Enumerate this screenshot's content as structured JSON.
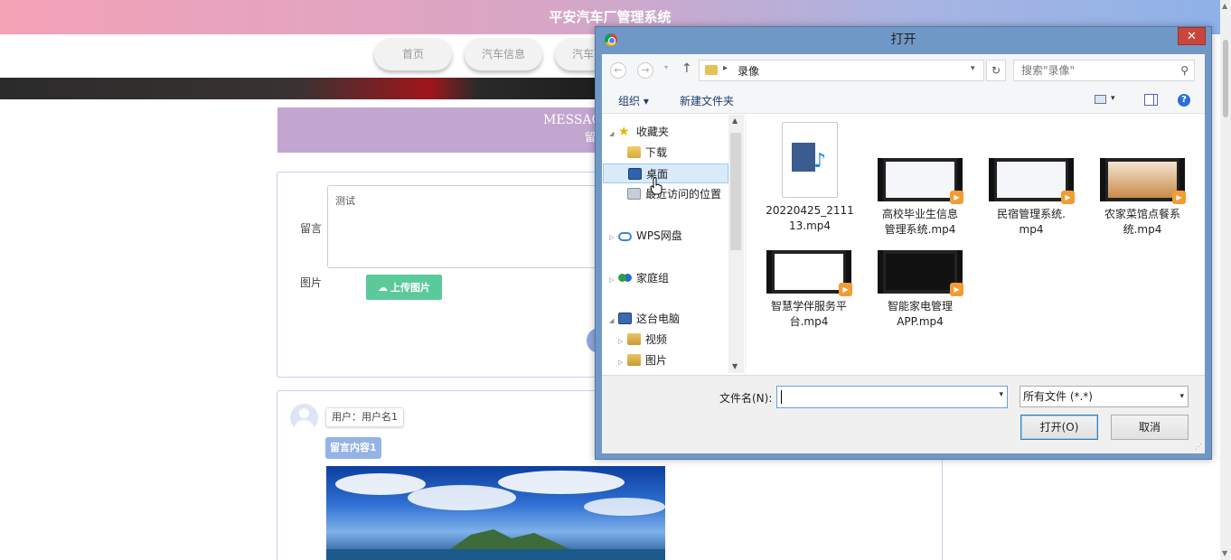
{
  "page": {
    "site_title": "平安汽车厂管理系统",
    "nav": [
      "首页",
      "汽车信息",
      "汽车配件"
    ],
    "section_title": "MESSAG",
    "section_subtitle": "留",
    "form": {
      "message_label": "留言",
      "message_value": "测试",
      "image_label": "图片",
      "upload_label": "上传图片"
    },
    "messages": [
      {
        "user": "用户：用户名1",
        "content": "留言内容1"
      }
    ]
  },
  "dialog": {
    "title": "打开",
    "close": "✕",
    "address": {
      "path": "录像"
    },
    "search_placeholder": "搜索\"录像\"",
    "toolbar": {
      "organize": "组织 ▾",
      "new_folder": "新建文件夹",
      "help": "?"
    },
    "tree": [
      {
        "label": "收藏夹",
        "icon": "star-icon",
        "expander": "◢"
      },
      {
        "label": "下载",
        "icon": "download-folder-icon"
      },
      {
        "label": "桌面",
        "icon": "desktop-icon",
        "selected": true
      },
      {
        "label": "最近访问的位置",
        "icon": "recent-places-icon"
      },
      {
        "label": "WPS网盘",
        "icon": "cloud-icon",
        "expander": "▷"
      },
      {
        "label": "家庭组",
        "icon": "homegroup-icon",
        "expander": "▷"
      },
      {
        "label": "这台电脑",
        "icon": "computer-icon",
        "expander": "◢"
      },
      {
        "label": "视频",
        "icon": "video-folder-icon",
        "expander": "▷"
      },
      {
        "label": "图片",
        "icon": "picture-folder-icon",
        "expander": "▷"
      }
    ],
    "files": [
      {
        "name": "20220425_211113.mp4",
        "line1": "20220425_2111",
        "line2": "13.mp4"
      },
      {
        "name": "高校毕业生信息管理系统.mp4",
        "line1": "高校毕业生信息",
        "line2": "管理系统.mp4"
      },
      {
        "name": "民宿管理系统.mp4",
        "line1": "民宿管理系统.",
        "line2": "mp4"
      },
      {
        "name": "农家菜馆点餐系统.mp4",
        "line1": "农家菜馆点餐系",
        "line2": "统.mp4"
      },
      {
        "name": "智慧学伴服务平台.mp4",
        "line1": "智慧学伴服务平",
        "line2": "台.mp4"
      },
      {
        "name": "智能家电管理APP.mp4",
        "line1": "智能家电管理",
        "line2": "APP.mp4"
      }
    ],
    "filename_label": "文件名(N):",
    "filename_value": "",
    "filetype": "所有文件 (*.*)",
    "open_button": "打开(O)",
    "cancel_button": "取消"
  },
  "colors": {
    "accent": "#5cc99a",
    "message_tag": "#94b3e6",
    "dialog_frame": "#6f98c6",
    "close_red": "#c9473a"
  }
}
